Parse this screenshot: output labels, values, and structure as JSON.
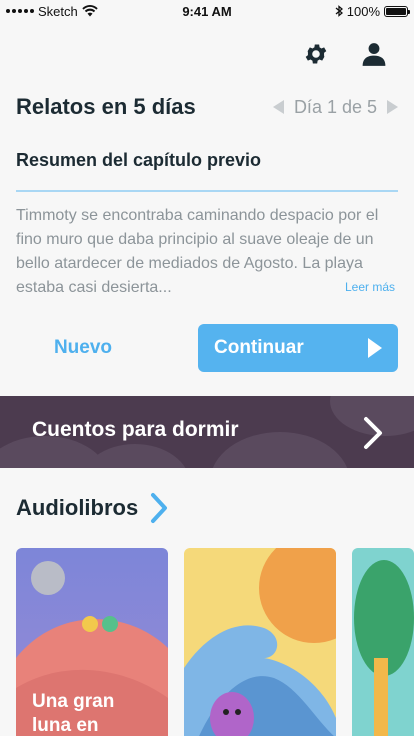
{
  "status": {
    "carrier": "Sketch",
    "time": "9:41 AM",
    "battery": "100%"
  },
  "header": {
    "title": "Relatos en 5 días",
    "day_label": "Día 1 de 5"
  },
  "summary": {
    "title": "Resumen del capítulo previo",
    "text": "Timmoty se encontraba caminando despacio por el fino muro que daba principio al suave oleaje de un bello atardecer de mediados de Agosto. La playa estaba casi desierta...",
    "read_more": "Leer más"
  },
  "actions": {
    "new_label": "Nuevo",
    "continue_label": "Continuar"
  },
  "banner": {
    "label": "Cuentos para dormir"
  },
  "audiobooks": {
    "title": "Audiolibros",
    "cards": [
      {
        "label": "Una gran luna en"
      },
      {
        "label": ""
      },
      {
        "label": ""
      }
    ]
  },
  "colors": {
    "accent": "#4eb0ee",
    "banner": "#4c3b4f",
    "text_dark": "#1c2b33"
  }
}
